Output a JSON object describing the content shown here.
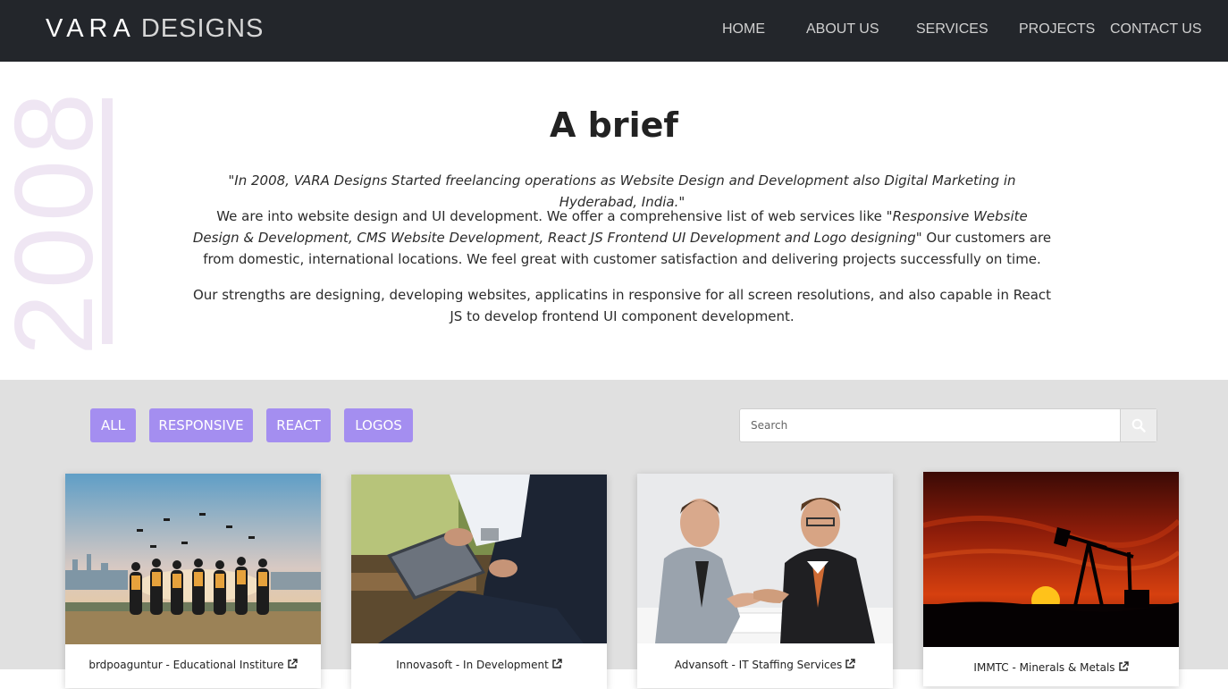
{
  "header": {
    "logo_primary": "VARA",
    "logo_secondary": "DESIGNS",
    "nav": [
      "HOME",
      "ABOUT US",
      "SERVICES",
      "PROJECTS",
      "CONTACT US"
    ]
  },
  "brief": {
    "year": "2008",
    "title": "A brief",
    "quote": "\"In 2008, VARA Designs Started freelancing operations as Website Design and Development also Digital Marketing in Hyderabad, India.\"",
    "p2_start": "We are into website design and UI development. We offer a comprehensive list of web services like ",
    "p2_services": "\"Responsive Website Design & Development, CMS Website Development, React JS Frontend UI Development and Logo designing\"",
    "p2_end": " Our customers are from domestic, international locations. We feel great with customer satisfaction and delivering projects successfully on time.",
    "p3": "Our strengths are designing, developing websites, applicatins in responsive for all screen resolutions, and also capable in React JS to develop frontend UI component development."
  },
  "projects": {
    "filters": [
      "ALL",
      "RESPONSIVE",
      "REACT",
      "LOGOS"
    ],
    "search_placeholder": "Search",
    "cards": [
      {
        "title": "brdpoaguntur - Educational Institure",
        "image": "graduation-photo"
      },
      {
        "title": "Innovasoft - In Development",
        "image": "business-tablet-photo"
      },
      {
        "title": "Advansoft - IT Staffing Services",
        "image": "handshake-photo"
      },
      {
        "title": "IMMTC - Minerals & Metals",
        "image": "oil-pump-sunset-photo"
      }
    ]
  },
  "colors": {
    "header_bg": "#23262b",
    "accent": "#a48ef0",
    "logo_accent": "#c2185b",
    "section_bg": "#e0e0e0",
    "year_tint": "#efe6f3"
  }
}
